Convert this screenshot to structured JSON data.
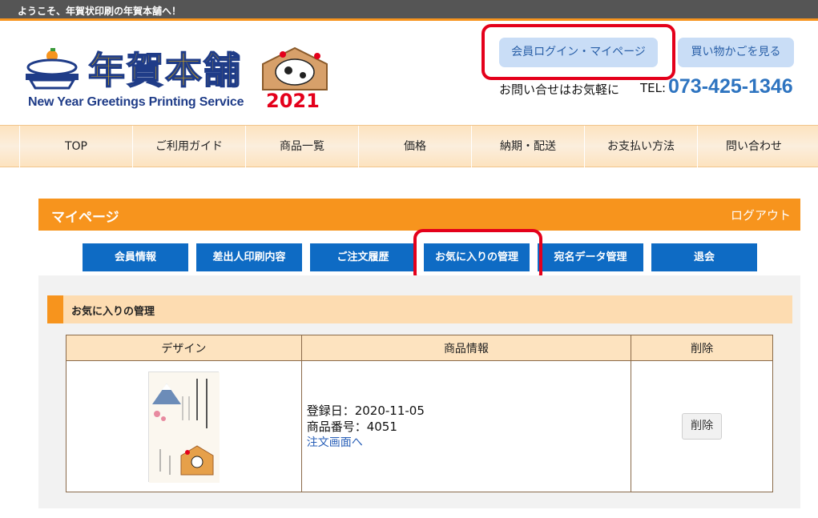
{
  "topbar": {
    "welcome": "ようこそ、年賀状印刷の年賀本舗へ！"
  },
  "logo": {
    "title": "年賀本舗",
    "subtitle": "New Year Greetings Printing Service",
    "year": "2021"
  },
  "header": {
    "login_label": "会員ログイン・マイページ",
    "cart_label": "買い物かごを見る",
    "contact_text": "お問い合せはお気軽に",
    "tel_label": "TEL:",
    "tel_number": "073-425-1346"
  },
  "nav": {
    "items": [
      "TOP",
      "ご利用ガイド",
      "商品一覧",
      "価格",
      "納期・配送",
      "お支払い方法",
      "問い合わせ"
    ]
  },
  "mypage": {
    "title": "マイページ",
    "logout": "ログアウト",
    "tabs": [
      "会員情報",
      "差出人印刷内容",
      "ご注文履歴",
      "お気に入りの管理",
      "宛名データ管理",
      "退会"
    ]
  },
  "favorites": {
    "section_title": "お気に入りの管理",
    "columns": [
      "デザイン",
      "商品情報",
      "削除"
    ],
    "rows": [
      {
        "registered": "登録日：2020-11-05",
        "product_no": "商品番号：4051",
        "order_link": "注文画面へ",
        "delete_label": "削除"
      }
    ]
  },
  "colors": {
    "accent": "#f7941d",
    "tab": "#0e6bc4",
    "highlight": "#e4001b",
    "link": "#2a60b8"
  }
}
